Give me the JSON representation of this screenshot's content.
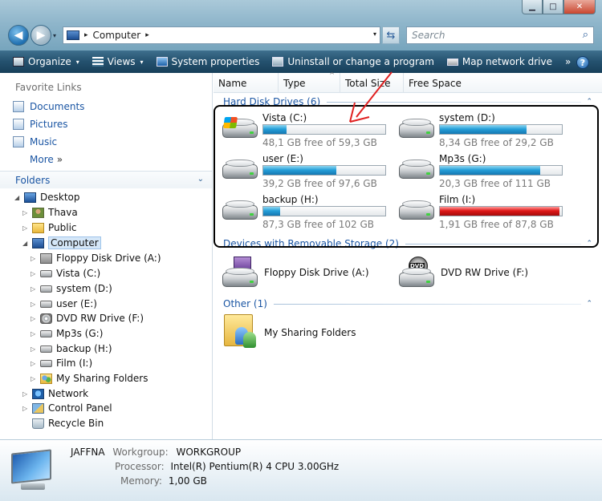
{
  "window": {
    "minimize_glyph": "▁",
    "maximize_glyph": "□",
    "close_glyph": "✕"
  },
  "nav": {
    "back_glyph": "◀",
    "forward_glyph": "▶",
    "history_glyph": "▾"
  },
  "address": {
    "separator": "▸",
    "path": "Computer",
    "path_separator": "▸",
    "dropdown_glyph": "▾"
  },
  "refresh_glyph": "⇆",
  "search": {
    "placeholder": "Search",
    "icon_glyph": "⌕"
  },
  "toolbar": {
    "organize": "Organize",
    "views": "Views",
    "system_properties": "System properties",
    "uninstall": "Uninstall or change a program",
    "map_network_drive": "Map network drive",
    "overflow": "»",
    "help": "?",
    "dropdown_glyph": "▾"
  },
  "sidebar": {
    "favorite_links_title": "Favorite Links",
    "favorites": [
      {
        "label": "Documents"
      },
      {
        "label": "Pictures"
      },
      {
        "label": "Music"
      }
    ],
    "more_label": "More",
    "more_glyph": "»",
    "folders_label": "Folders",
    "folders_chevron": "⌄",
    "tree": [
      {
        "label": "Desktop",
        "expander": "◢"
      },
      {
        "label": "Thava",
        "expander": "▷"
      },
      {
        "label": "Public",
        "expander": "▷"
      },
      {
        "label": "Computer",
        "expander": "◢"
      },
      {
        "label": "Floppy Disk Drive (A:)",
        "expander": "▷"
      },
      {
        "label": "Vista (C:)",
        "expander": "▷"
      },
      {
        "label": "system (D:)",
        "expander": "▷"
      },
      {
        "label": "user (E:)",
        "expander": "▷"
      },
      {
        "label": "DVD RW Drive (F:)",
        "expander": "▷"
      },
      {
        "label": "Mp3s (G:)",
        "expander": "▷"
      },
      {
        "label": "backup (H:)",
        "expander": "▷"
      },
      {
        "label": "Film (I:)",
        "expander": "▷"
      },
      {
        "label": "My Sharing Folders",
        "expander": "▷"
      },
      {
        "label": "Network",
        "expander": "▷"
      },
      {
        "label": "Control Panel",
        "expander": "▷"
      },
      {
        "label": "Recycle Bin",
        "expander": ""
      }
    ]
  },
  "columns": [
    "Name",
    "Type",
    "Total Size",
    "Free Space"
  ],
  "sort_glyph": "^",
  "groups": {
    "hard_disk": "Hard Disk Drives (6)",
    "removable": "Devices with Removable Storage (2)",
    "other": "Other (1)",
    "chevron": "⌃"
  },
  "drives": [
    {
      "name": "Vista (C:)",
      "free_text": "48,1 GB free of 59,3 GB",
      "used_fraction": 0.19,
      "low": false
    },
    {
      "name": "system (D:)",
      "free_text": "8,34 GB free of 29,2 GB",
      "used_fraction": 0.71,
      "low": false
    },
    {
      "name": "user (E:)",
      "free_text": "39,2 GB free of 97,6 GB",
      "used_fraction": 0.6,
      "low": false
    },
    {
      "name": "Mp3s (G:)",
      "free_text": "20,3 GB free of 111 GB",
      "used_fraction": 0.82,
      "low": false
    },
    {
      "name": "backup (H:)",
      "free_text": "87,3 GB free of 102 GB",
      "used_fraction": 0.14,
      "low": false
    },
    {
      "name": "Film (I:)",
      "free_text": "1,91 GB free of 87,8 GB",
      "used_fraction": 0.98,
      "low": true
    }
  ],
  "removable": [
    {
      "name": "Floppy Disk Drive (A:)"
    },
    {
      "name": "DVD RW Drive (F:)"
    }
  ],
  "dvd_tag": "DVD",
  "other_items": [
    {
      "name": "My Sharing Folders"
    }
  ],
  "details": {
    "computer_name": "JAFFNA",
    "workgroup_key": "Workgroup:",
    "workgroup_val": "WORKGROUP",
    "processor_key": "Processor:",
    "processor_val": "Intel(R) Pentium(R) 4 CPU 3.00GHz",
    "memory_key": "Memory:",
    "memory_val": "1,00 GB"
  },
  "colors": {
    "link_blue": "#1a55a3",
    "bar_fill": "#26a0da",
    "bar_low": "#e01818",
    "annotation": "#e02020"
  }
}
